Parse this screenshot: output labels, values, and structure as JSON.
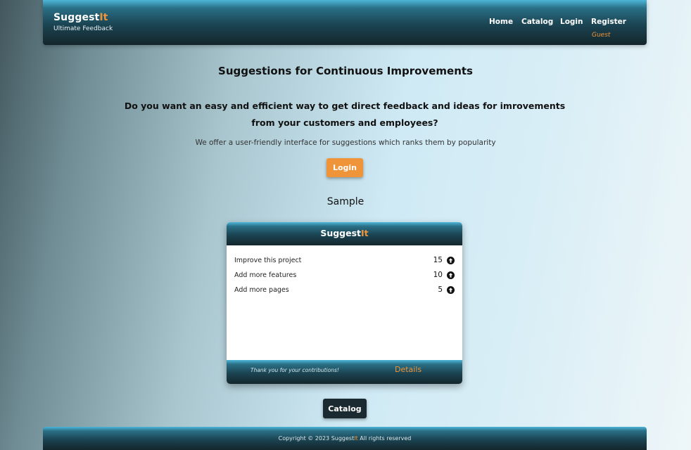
{
  "header": {
    "brand_main": "Suggest",
    "brand_accent": "It",
    "tagline": "Ultimate Feedback",
    "nav": {
      "home": "Home",
      "catalog": "Catalog",
      "login": "Login",
      "register": "Register"
    },
    "user_status": "Guest"
  },
  "main": {
    "title": "Suggestions for Continuous Improvements",
    "intro": "Do you want an easy and efficient way to get direct feedback and ideas for imrovements from your customers and employees?",
    "subtext": "We offer a user-friendly interface for suggestions which ranks them by popularity",
    "login_button": "Login",
    "sample_heading": "Sample",
    "catalog_button": "Catalog"
  },
  "sample_card": {
    "brand_main": "Suggest",
    "brand_accent": "It",
    "items": [
      {
        "label": "Improve this project",
        "count": "15",
        "icon": "arrow-up-circle-icon"
      },
      {
        "label": "Add more features",
        "count": "10",
        "icon": "arrow-up-circle-icon"
      },
      {
        "label": "Add more pages",
        "count": "5",
        "icon": "arrow-up-circle-icon"
      }
    ],
    "footer_note": "Thank you for your contributions!",
    "details_link": "Details"
  },
  "footer": {
    "copyright_prefix": "Copyright © 2023 Suggest",
    "copyright_accent": "It",
    "copyright_suffix": " All rights reserved"
  },
  "colors": {
    "accent": "#f0943a",
    "dark": "#1a2a30",
    "bar_top": "#4db6d9",
    "bar_bottom": "#14262c"
  }
}
